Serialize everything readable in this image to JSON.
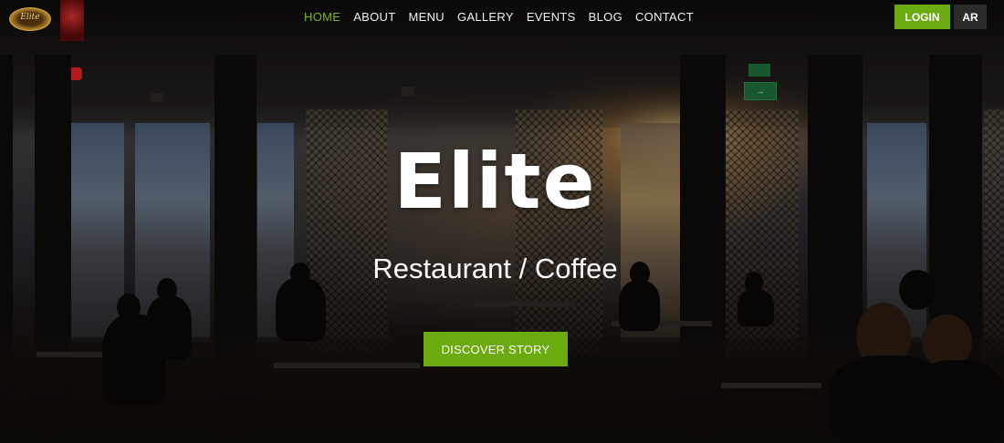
{
  "header": {
    "logo_text": "Elite",
    "nav": [
      {
        "label": "HOME",
        "active": true
      },
      {
        "label": "ABOUT"
      },
      {
        "label": "MENU"
      },
      {
        "label": "GALLERY"
      },
      {
        "label": "EVENTS"
      },
      {
        "label": "BLOG"
      },
      {
        "label": "CONTACT"
      }
    ],
    "login_label": "LOGIN",
    "language_label": "AR"
  },
  "hero": {
    "title": "Elite",
    "tagline": "Restaurant / Coffee",
    "cta_label": "DISCOVER STORY"
  },
  "colors": {
    "accent": "#6bab10",
    "active_nav": "#7cb518",
    "lang_button": "#2b2b2b"
  }
}
